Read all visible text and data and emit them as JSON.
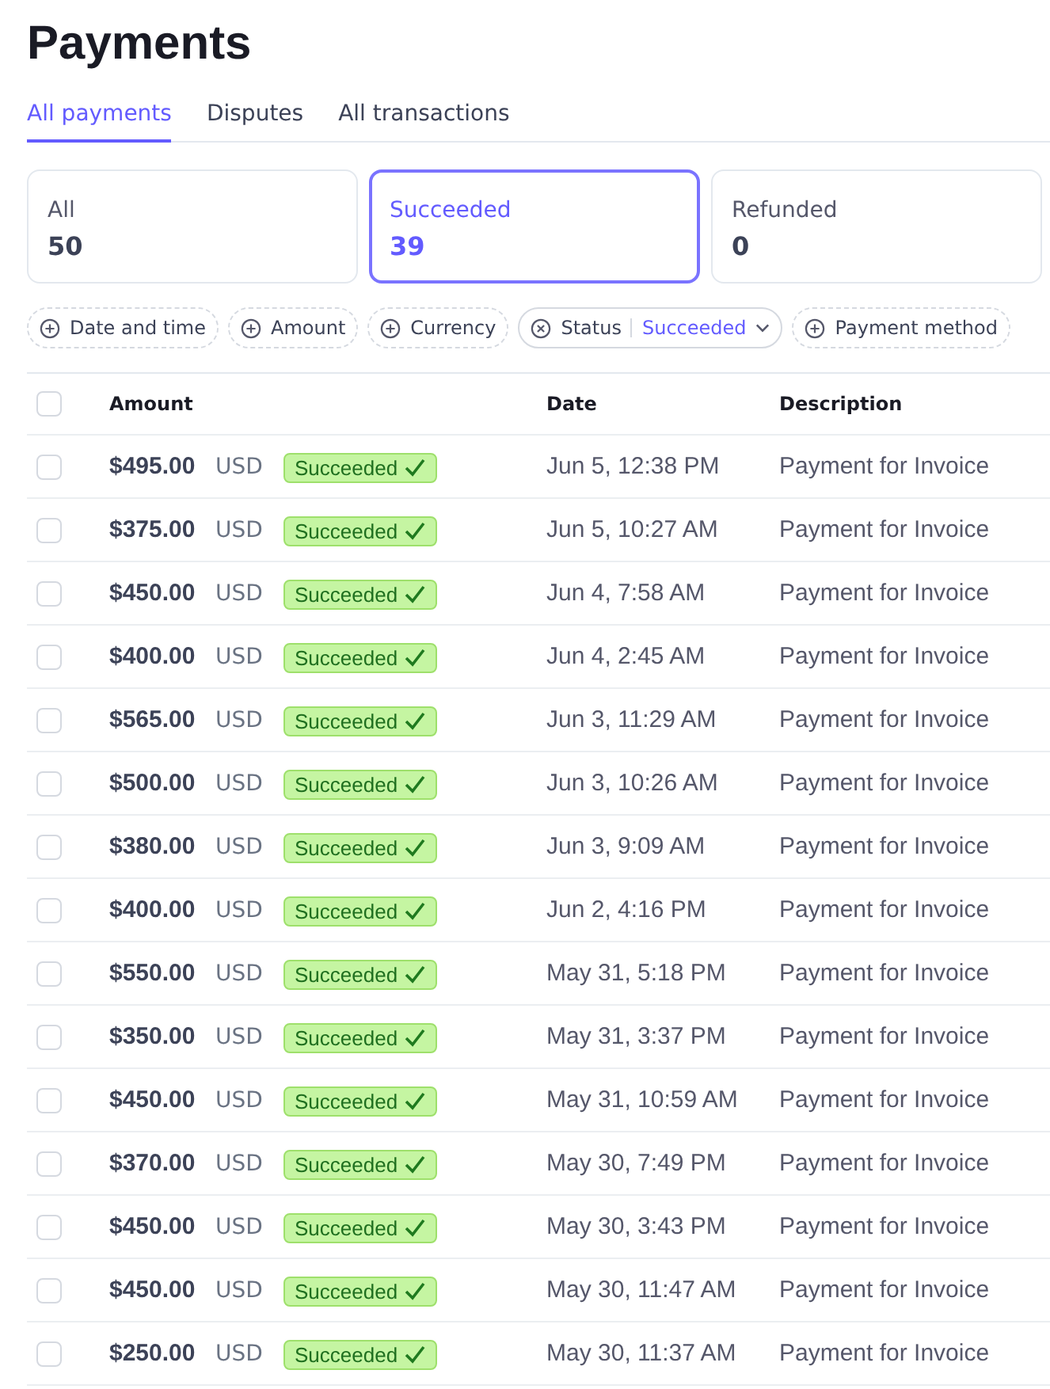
{
  "title": "Payments",
  "tabs": [
    {
      "label": "All payments",
      "selected": true
    },
    {
      "label": "Disputes",
      "selected": false
    },
    {
      "label": "All transactions",
      "selected": false
    }
  ],
  "summary_cards": [
    {
      "label": "All",
      "count": "50",
      "selected": false
    },
    {
      "label": "Succeeded",
      "count": "39",
      "selected": true
    },
    {
      "label": "Refunded",
      "count": "0",
      "selected": false
    }
  ],
  "filters": [
    {
      "kind": "add",
      "label": "Date and time"
    },
    {
      "kind": "add",
      "label": "Amount"
    },
    {
      "kind": "add",
      "label": "Currency"
    },
    {
      "kind": "active",
      "label": "Status",
      "value": "Succeeded"
    },
    {
      "kind": "add",
      "label": "Payment method"
    }
  ],
  "table": {
    "select_all_checked": false,
    "columns": [
      "Amount",
      "Date",
      "Description"
    ],
    "rows": [
      {
        "checked": false,
        "amount": "$495.00",
        "currency": "USD",
        "status": "Succeeded",
        "kind": "succeeded",
        "date": "Jun 5, 12:38 PM",
        "description": "Payment for Invoice"
      },
      {
        "checked": false,
        "amount": "$375.00",
        "currency": "USD",
        "status": "Succeeded",
        "kind": "succeeded",
        "date": "Jun 5, 10:27 AM",
        "description": "Payment for Invoice"
      },
      {
        "checked": false,
        "amount": "$450.00",
        "currency": "USD",
        "status": "Succeeded",
        "kind": "succeeded",
        "date": "Jun 4, 7:58 AM",
        "description": "Payment for Invoice"
      },
      {
        "checked": false,
        "amount": "$400.00",
        "currency": "USD",
        "status": "Succeeded",
        "kind": "succeeded",
        "date": "Jun 4, 2:45 AM",
        "description": "Payment for Invoice"
      },
      {
        "checked": false,
        "amount": "$565.00",
        "currency": "USD",
        "status": "Succeeded",
        "kind": "succeeded",
        "date": "Jun 3, 11:29 AM",
        "description": "Payment for Invoice"
      },
      {
        "checked": false,
        "amount": "$500.00",
        "currency": "USD",
        "status": "Succeeded",
        "kind": "succeeded",
        "date": "Jun 3, 10:26 AM",
        "description": "Payment for Invoice"
      },
      {
        "checked": false,
        "amount": "$380.00",
        "currency": "USD",
        "status": "Succeeded",
        "kind": "succeeded",
        "date": "Jun 3, 9:09 AM",
        "description": "Payment for Invoice"
      },
      {
        "checked": false,
        "amount": "$400.00",
        "currency": "USD",
        "status": "Succeeded",
        "kind": "succeeded",
        "date": "Jun 2, 4:16 PM",
        "description": "Payment for Invoice"
      },
      {
        "checked": false,
        "amount": "$550.00",
        "currency": "USD",
        "status": "Succeeded",
        "kind": "succeeded",
        "date": "May 31, 5:18 PM",
        "description": "Payment for Invoice"
      },
      {
        "checked": false,
        "amount": "$350.00",
        "currency": "USD",
        "status": "Succeeded",
        "kind": "succeeded",
        "date": "May 31, 3:37 PM",
        "description": "Payment for Invoice"
      },
      {
        "checked": false,
        "amount": "$450.00",
        "currency": "USD",
        "status": "Succeeded",
        "kind": "succeeded",
        "date": "May 31, 10:59 AM",
        "description": "Payment for Invoice"
      },
      {
        "checked": false,
        "amount": "$370.00",
        "currency": "USD",
        "status": "Succeeded",
        "kind": "succeeded",
        "date": "May 30, 7:49 PM",
        "description": "Payment for Invoice"
      },
      {
        "checked": false,
        "amount": "$450.00",
        "currency": "USD",
        "status": "Succeeded",
        "kind": "succeeded",
        "date": "May 30, 3:43 PM",
        "description": "Payment for Invoice"
      },
      {
        "checked": false,
        "amount": "$450.00",
        "currency": "USD",
        "status": "Succeeded",
        "kind": "succeeded",
        "date": "May 30, 11:47 AM",
        "description": "Payment for Invoice"
      },
      {
        "checked": false,
        "amount": "$250.00",
        "currency": "USD",
        "status": "Succeeded",
        "kind": "succeeded",
        "date": "May 30, 11:37 AM",
        "description": "Payment for Invoice"
      }
    ]
  }
}
